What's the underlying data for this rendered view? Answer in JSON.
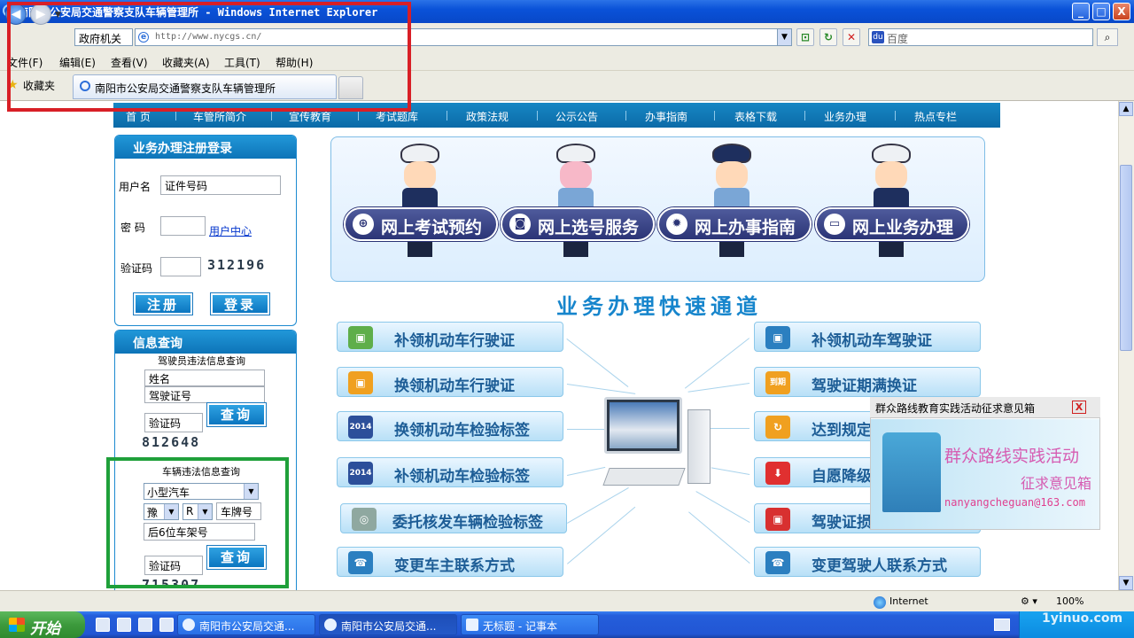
{
  "window": {
    "title": "南阳市公安局交通警察支队车辆管理所 - Windows Internet Explorer",
    "buttons": [
      "_",
      "□",
      "X"
    ]
  },
  "addressbar": {
    "dropdown": "政府机关",
    "url": "http://www.nycgs.cn/",
    "search_placeholder": "百度"
  },
  "menu": [
    "文件(F)",
    "编辑(E)",
    "查看(V)",
    "收藏夹(A)",
    "工具(T)",
    "帮助(H)"
  ],
  "favorites": {
    "label": "收藏夹",
    "tab_title": "南阳市公安局交通警察支队车辆管理所"
  },
  "site_nav": [
    "首 页",
    "车管所简介",
    "宣传教育",
    "考试题库",
    "政策法规",
    "公示公告",
    "办事指南",
    "表格下载",
    "业务办理",
    "热点专栏"
  ],
  "login": {
    "title": "业务办理注册登录",
    "username_label": "用户名",
    "username_value": "证件号码",
    "password_label": "密  码",
    "user_center": "用户中心",
    "captcha_label": "验证码",
    "captcha": "312196",
    "register": "注册",
    "login": "登录"
  },
  "query": {
    "title": "信息查询",
    "driver_title": "驾驶员违法信息查询",
    "name_field": "姓名",
    "license_field": "驾驶证号",
    "captcha_label": "验证码",
    "captcha": "812648",
    "query_btn": "查询",
    "vehicle_title": "车辆违法信息查询",
    "vehicle_type": "小型汽车",
    "province": "豫",
    "letter": "R",
    "plate_field": "车牌号",
    "frame_field": "后6位车架号",
    "captcha2": "715307"
  },
  "banner": [
    "网上考试预约",
    "网上选号服务",
    "网上办事指南",
    "网上业务办理"
  ],
  "quick": {
    "title": "业务办理快速通道",
    "left": [
      {
        "label": "补领机动车行驶证",
        "icon_color": "#5fae4a"
      },
      {
        "label": "换领机动车行驶证",
        "icon_color": "#f0a020"
      },
      {
        "label": "换领机动车检验标签",
        "icon_color": "#2c4f9a"
      },
      {
        "label": "补领机动车检验标签",
        "icon_color": "#2c4f9a"
      },
      {
        "label": "委托核发车辆检验标签",
        "icon_color": "#8fa8a0"
      },
      {
        "label": "变更车主联系方式",
        "icon_color": "#2b7fc0"
      }
    ],
    "right": [
      {
        "label": "补领机动车驾驶证",
        "icon_color": "#2b7fc0"
      },
      {
        "label": "驾驶证期满换证",
        "icon_color": "#f0a020"
      },
      {
        "label": "达到规定",
        "icon_color": "#f0a020"
      },
      {
        "label": "自愿降级",
        "icon_color": "#e03030"
      },
      {
        "label": "驾驶证损",
        "icon_color": "#d83030"
      },
      {
        "label": "变更驾驶人联系方式",
        "icon_color": "#2b7fc0"
      }
    ]
  },
  "popup": {
    "title": "群众路线教育实践活动征求意见箱",
    "line1": "群众路线实践活动",
    "line2": "征求意见箱",
    "email": "nanyangcheguan@163.com"
  },
  "status": {
    "zone": "Internet",
    "zoom": "100%"
  },
  "taskbar": {
    "start": "开始",
    "tasks": [
      "南阳市公安局交通...",
      "南阳市公安局交通...",
      "无标题 - 记事本"
    ],
    "watermark": "1yinuo.com"
  }
}
